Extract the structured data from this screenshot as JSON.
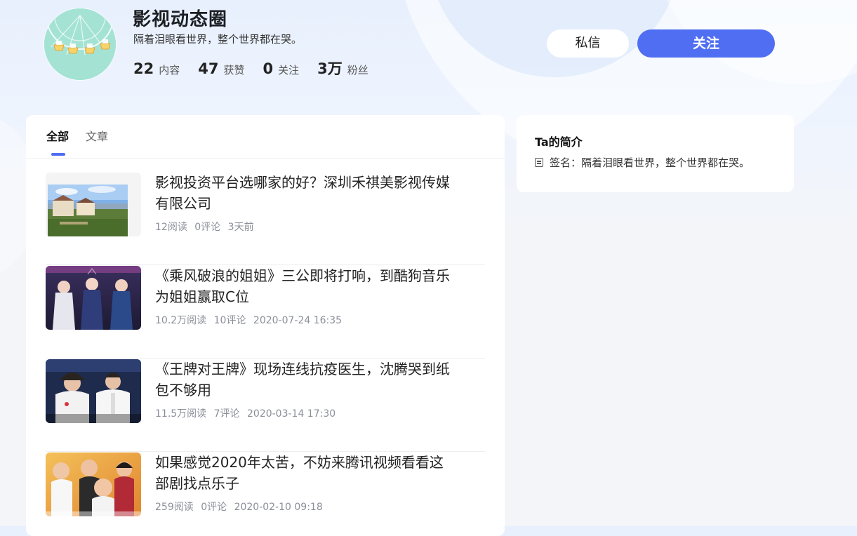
{
  "profile": {
    "name": "影视动态圈",
    "signature": "隔着泪眼看世界，整个世界都在哭。",
    "stats": [
      {
        "value": "22",
        "label": "内容"
      },
      {
        "value": "47",
        "label": "获赞"
      },
      {
        "value": "0",
        "label": "关注"
      },
      {
        "value": "3万",
        "label": "粉丝"
      }
    ],
    "message_label": "私信",
    "follow_label": "关注"
  },
  "tabs": [
    {
      "label": "全部",
      "active": true
    },
    {
      "label": "文章",
      "active": false
    }
  ],
  "articles": [
    {
      "title": "影视投资平台选哪家的好？深圳禾祺美影视传媒有限公司",
      "reads": "12阅读",
      "comments": "0评论",
      "time": "3天前",
      "thumb_icon": "resort-landscape-image"
    },
    {
      "title": "《乘风破浪的姐姐》三公即将打响，到酷狗音乐为姐姐赢取C位",
      "reads": "10.2万阅读",
      "comments": "10评论",
      "time": "2020-07-24 16:35",
      "thumb_icon": "stage-performers-image"
    },
    {
      "title": "《王牌对王牌》现场连线抗疫医生，沈腾哭到纸包不够用",
      "reads": "11.5万阅读",
      "comments": "7评论",
      "time": "2020-03-14 17:30",
      "thumb_icon": "tv-show-guests-image"
    },
    {
      "title": "如果感觉2020年太苦，不妨来腾讯视频看看这部剧找点乐子",
      "reads": "259阅读",
      "comments": "0评论",
      "time": "2020-02-10 09:18",
      "thumb_icon": "tv-drama-cast-image"
    }
  ],
  "intro": {
    "title": "Ta的简介",
    "signature": "签名：隔着泪眼看世界，整个世界都在哭。",
    "icon": "document-icon"
  },
  "colors": {
    "accent": "#4f6ef2",
    "meta_text": "#8a8f99"
  }
}
